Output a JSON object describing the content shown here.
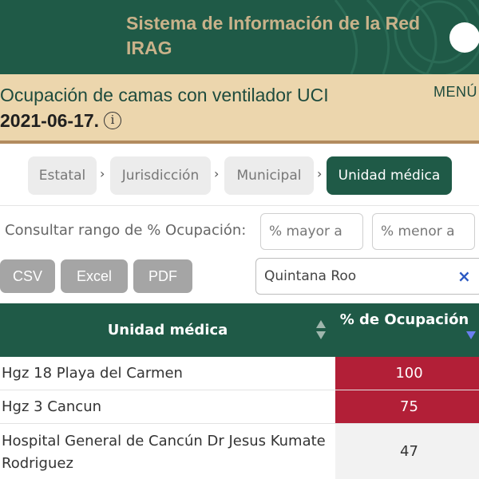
{
  "header": {
    "title": "Sistema de Información de la Red IRAG"
  },
  "subheader": {
    "title": "Ocupación de camas con ventilador UCI",
    "date": "2021-06-17.",
    "menu": "MENÚ"
  },
  "breadcrumb": {
    "items": [
      "Estatal",
      "Jurisdicción",
      "Municipal",
      "Unidad médica"
    ],
    "separator": "›",
    "active_index": 3
  },
  "filters": {
    "label": "Consultar rango de % Ocupación:",
    "min_placeholder": "% mayor a",
    "max_placeholder": "% menor a"
  },
  "export": {
    "csv": "CSV",
    "excel": "Excel",
    "pdf": "PDF"
  },
  "search": {
    "value": "Quintana Roo",
    "clear": "×"
  },
  "table": {
    "columns": [
      "Unidad médica",
      "% de Ocupación"
    ],
    "rows": [
      {
        "unidad": "Hgz 18 Playa del Carmen",
        "ocupacion": "100",
        "status": "high"
      },
      {
        "unidad": "Hgz 3 Cancun",
        "ocupacion": "75",
        "status": "high"
      },
      {
        "unidad": "Hospital General de Cancún Dr Jesus Kumate Rodriguez",
        "ocupacion": "47",
        "status": "normal"
      }
    ]
  },
  "colors": {
    "primary": "#1f5a47",
    "gold": "#c9b28a",
    "banner": "#ecd6ad",
    "high": "#b21f37",
    "button": "#a5a5a5"
  }
}
